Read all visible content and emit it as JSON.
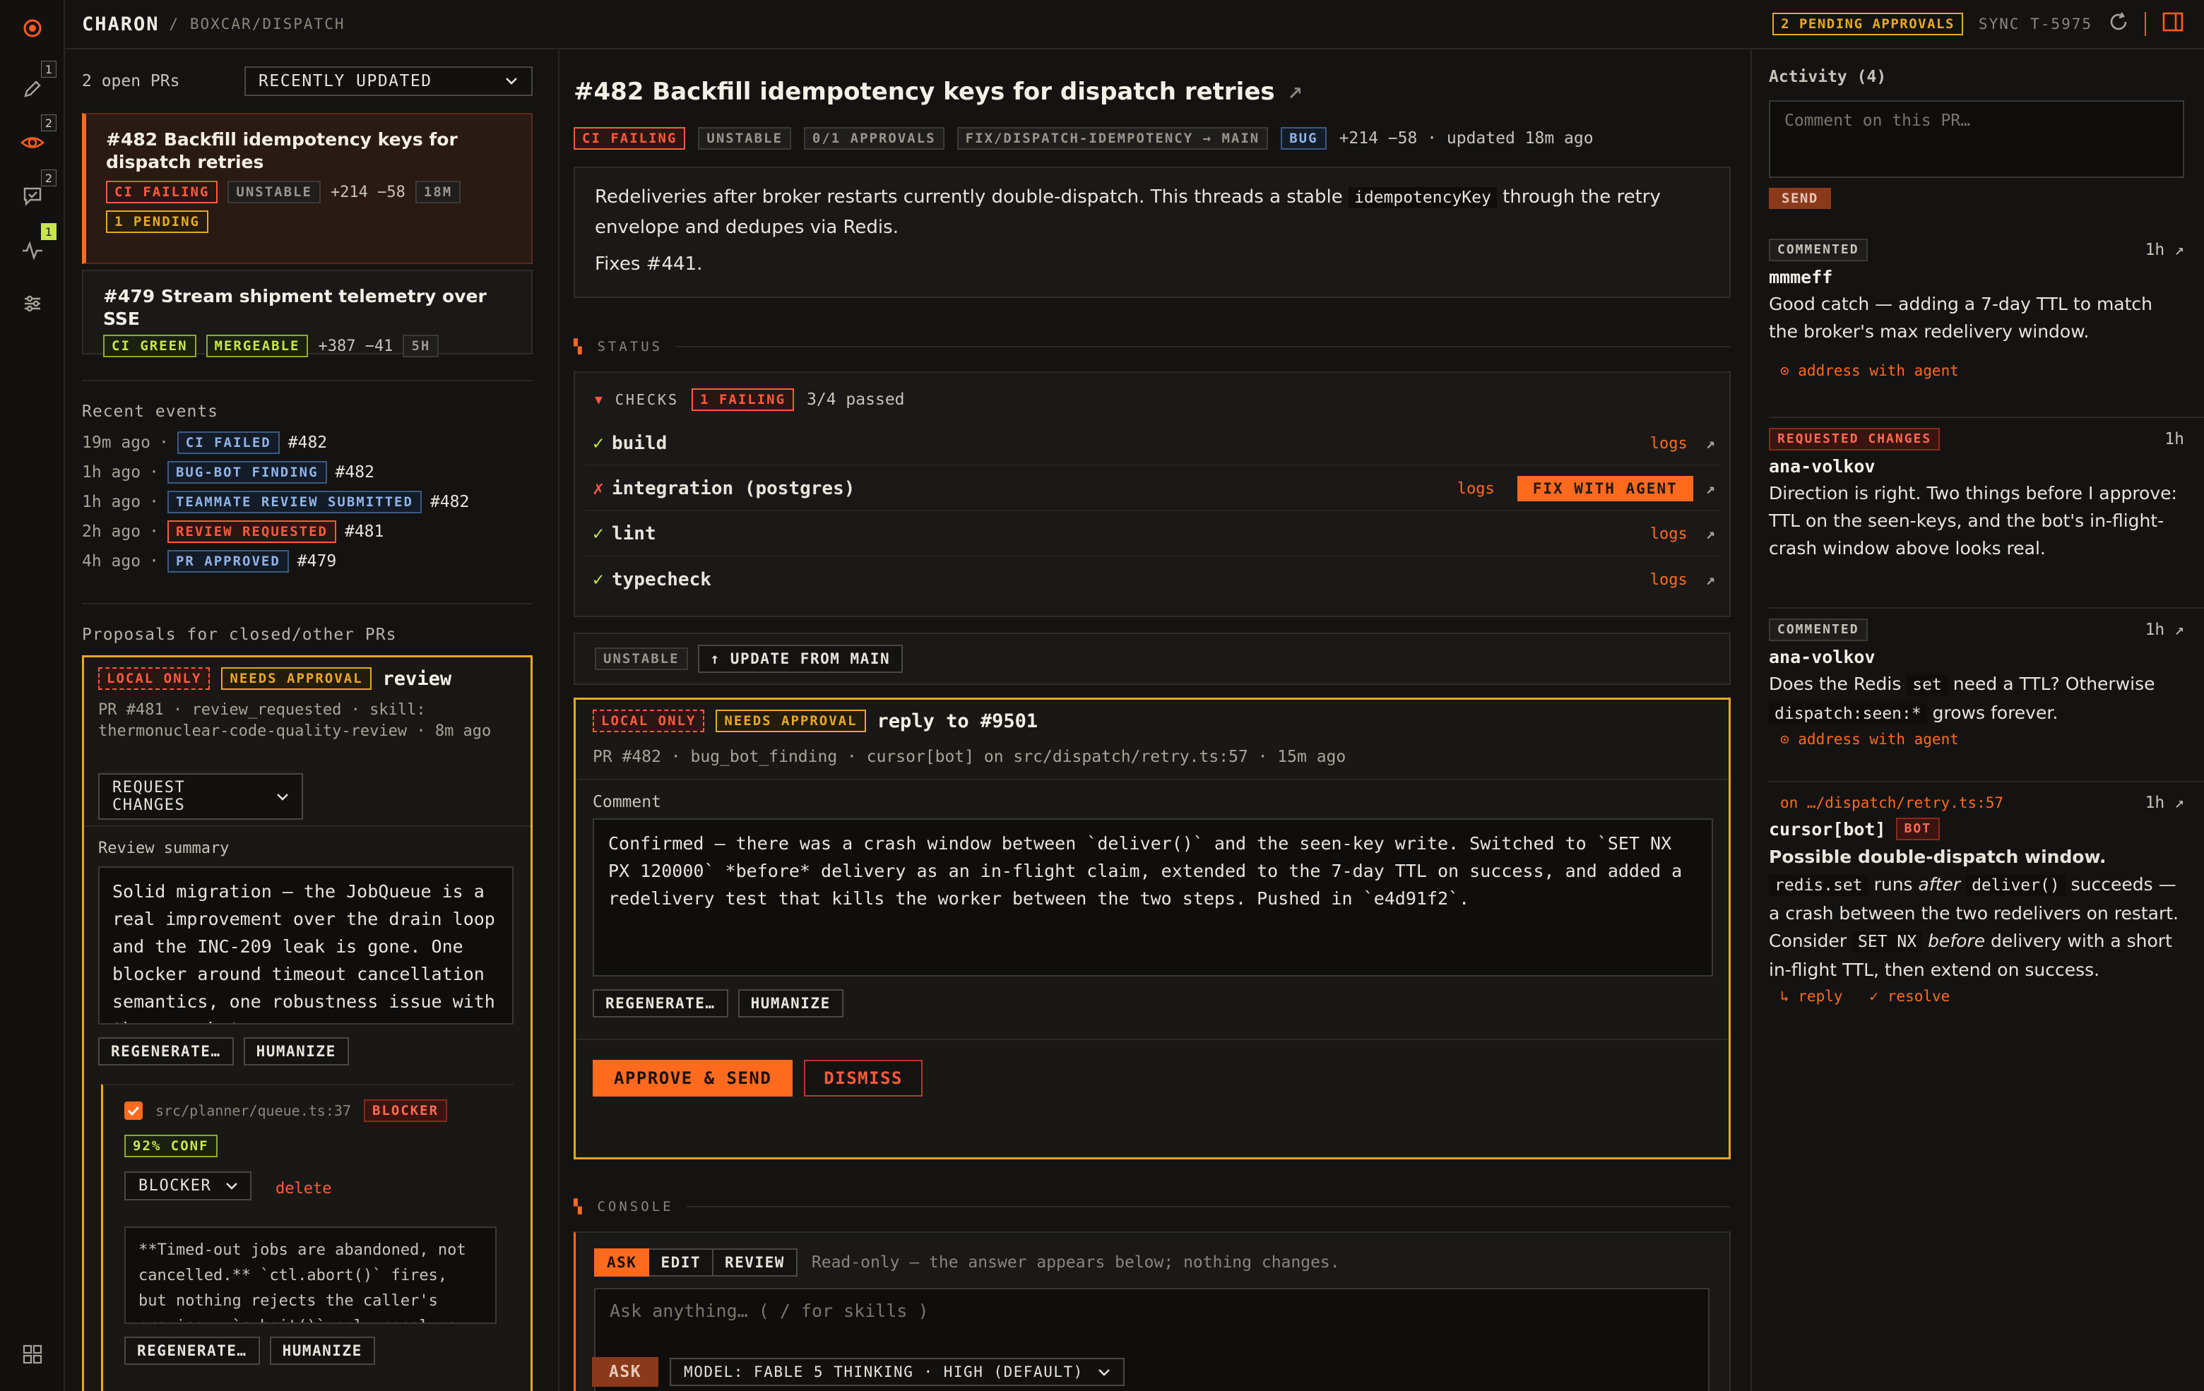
{
  "app": {
    "brand": "CHARON",
    "breadcrumb": "/ BOXCAR/DISPATCH"
  },
  "topbar": {
    "pending": "2 PENDING APPROVALS",
    "sync": "SYNC T-5975"
  },
  "rail": {
    "badges": [
      "1",
      "2",
      "2",
      "1"
    ]
  },
  "left": {
    "open_count": "2 open PRs",
    "sort": "RECENTLY UPDATED",
    "prs": [
      {
        "title": "#482 Backfill idempotency keys for dispatch retries",
        "tags": [
          "CI FAILING",
          "UNSTABLE"
        ],
        "diff": "+214 −58",
        "age": "18M",
        "pending": "1 PENDING"
      },
      {
        "title": "#479 Stream shipment telemetry over SSE",
        "tags": [
          "CI GREEN",
          "MERGEABLE"
        ],
        "diff": "+387 −41",
        "age": "5H"
      }
    ],
    "recent_title": "Recent events",
    "events": [
      {
        "time": "19m ago",
        "sep": "·",
        "tag": "CI FAILED",
        "pr": "#482"
      },
      {
        "time": "1h ago",
        "sep": "·",
        "tag": "BUG-BOT FINDING",
        "pr": "#482"
      },
      {
        "time": "1h ago",
        "sep": "·",
        "tag": "TEAMMATE REVIEW SUBMITTED",
        "pr": "#482"
      },
      {
        "time": "2h ago",
        "sep": "·",
        "tag": "REVIEW REQUESTED",
        "pr": "#481"
      },
      {
        "time": "4h ago",
        "sep": "·",
        "tag": "PR APPROVED",
        "pr": "#479"
      }
    ],
    "proposals_title": "Proposals for closed/other PRs",
    "proposal": {
      "tag_local": "LOCAL ONLY",
      "tag_approval": "NEEDS APPROVAL",
      "kind": "review",
      "meta": "PR #481 · review_requested · skill: thermonuclear-code-quality-review · 8m ago",
      "action": "REQUEST CHANGES",
      "summary_label": "Review summary",
      "summary": "Solid migration — the JobQueue is a real improvement over the drain loop and the INC-209 leak is gone. One blocker around timeout cancellation semantics, one robustness issue with the race between ",
      "regenerate": "REGENERATE…",
      "humanize": "HUMANIZE",
      "finding": {
        "path": "src/planner/queue.ts:37",
        "severity": "BLOCKER",
        "conf": "92% CONF",
        "severity_select": "BLOCKER",
        "delete": "delete",
        "text": "**Timed-out jobs are abandoned, not cancelled.** `ctl.abort()` fires, but nothing rejects the caller's promise — `submit()` only resolves on",
        "regenerate": "REGENERATE…",
        "humanize": "HUMANIZE"
      }
    }
  },
  "main": {
    "title": "#482 Backfill idempotency keys for dispatch retries",
    "tags": [
      "CI FAILING",
      "UNSTABLE",
      "0/1 APPROVALS",
      "FIX/DISPATCH-IDEMPOTENCY → MAIN",
      "BUG"
    ],
    "diff_meta": "+214 −58 · updated 18m ago",
    "desc_before": "Redeliveries after broker restarts currently double-dispatch. This threads a stable ",
    "desc_code": "idempotencyKey",
    "desc_after": " through the retry envelope and dedupes via Redis.",
    "fixes": "Fixes #441.",
    "status_label": "STATUS",
    "checks_label": "CHECKS",
    "checks_failing": "1 FAILING",
    "checks_passed": "3/4 passed",
    "checks": [
      {
        "mark": "✓",
        "name": "build",
        "logs": "logs"
      },
      {
        "mark": "✗",
        "name": "integration (postgres)",
        "logs": "logs",
        "fix": "FIX WITH AGENT"
      },
      {
        "mark": "✓",
        "name": "lint",
        "logs": "logs"
      },
      {
        "mark": "✓",
        "name": "typecheck",
        "logs": "logs"
      }
    ],
    "merge_state": "UNSTABLE",
    "update_btn": "↑ UPDATE FROM MAIN",
    "reply": {
      "tag_local": "LOCAL ONLY",
      "tag_approval": "NEEDS APPROVAL",
      "title": "reply to #9501",
      "meta": "PR #482 · bug_bot_finding · cursor[bot] on src/dispatch/retry.ts:57 · 15m ago",
      "comment_label": "Comment",
      "comment": "Confirmed — there was a crash window between `deliver()` and the seen-key write. Switched to `SET NX PX 120000` *before* delivery as an in-flight claim, extended to the 7-day TTL on success, and added a redelivery test that kills the worker between the two steps. Pushed in `e4d91f2`.",
      "regenerate": "REGENERATE…",
      "humanize": "HUMANIZE",
      "approve": "APPROVE & SEND",
      "dismiss": "DISMISS"
    },
    "console_label": "CONSOLE",
    "console": {
      "tabs": [
        "ASK",
        "EDIT",
        "REVIEW"
      ],
      "hint": "Read-only — the answer appears below; nothing changes.",
      "placeholder": "Ask anything…  ( / for skills )",
      "ask": "ASK",
      "model": "MODEL: FABLE 5 THINKING · HIGH (DEFAULT)"
    }
  },
  "right": {
    "title": "Activity (4)",
    "placeholder": "Comment on this PR…",
    "send": "SEND",
    "items": [
      {
        "kind": "COMMENTED",
        "time": "1h",
        "user": "mmmeff",
        "body": "Good catch — adding a 7-day TTL to match the broker's max redelivery window.",
        "link": "⊙ address with agent"
      },
      {
        "kind": "REQUESTED CHANGES",
        "time": "1h",
        "user": "ana-volkov",
        "body": "Direction is right. Two things before I approve: TTL on the seen-keys, and the bot's in-flight-crash window above looks real."
      },
      {
        "kind": "COMMENTED",
        "time": "1h",
        "user": "ana-volkov",
        "body_a": "Does the Redis ",
        "code_a": "set",
        "body_b": " need a TTL? Otherwise ",
        "code_b": "dispatch:seen:*",
        "body_c": " grows forever.",
        "link": "⊙ address with agent"
      },
      {
        "path": "on …/dispatch/retry.ts:57",
        "time": "1h",
        "user": "cursor[bot]",
        "badge": "BOT",
        "b1": "Possible double-dispatch window.",
        "c1": "redis.set",
        "b2": " runs ",
        "i1": "after",
        "c2": "deliver()",
        "b3": " succeeds — a crash between the two redelivers on restart. Consider ",
        "c3": "SET NX",
        "i2": "before",
        "b4": " delivery with a short in-flight TTL, then extend on success.",
        "reply": "↳ reply",
        "resolve": "✓ resolve"
      }
    ]
  }
}
